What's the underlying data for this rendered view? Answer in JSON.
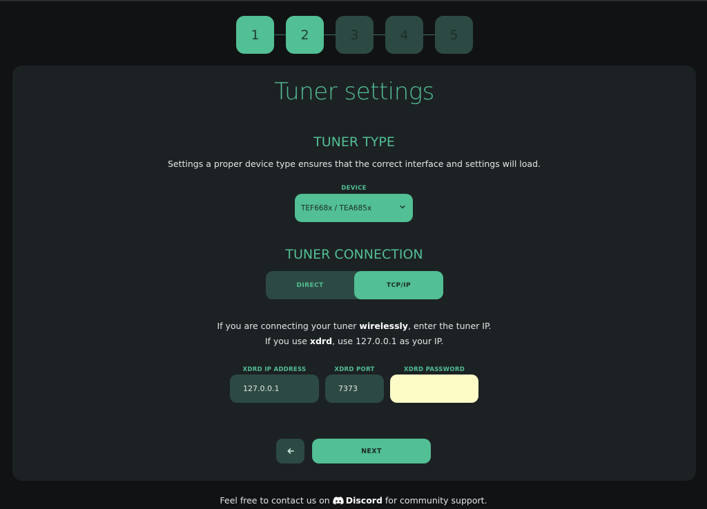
{
  "stepper": {
    "steps": [
      {
        "label": "1",
        "state": "active"
      },
      {
        "label": "2",
        "state": "active"
      },
      {
        "label": "3",
        "state": "inactive"
      },
      {
        "label": "4",
        "state": "inactive"
      },
      {
        "label": "5",
        "state": "inactive"
      }
    ]
  },
  "page": {
    "title": "Tuner settings"
  },
  "tuner_type": {
    "heading": "TUNER TYPE",
    "description": "Settings a proper device type ensures that the correct interface and settings will load.",
    "device_label": "DEVICE",
    "device_value": "TEF668x / TEA685x"
  },
  "tuner_connection": {
    "heading": "TUNER CONNECTION",
    "options": [
      {
        "label": "DIRECT",
        "selected": false
      },
      {
        "label": "TCP/IP",
        "selected": true
      }
    ],
    "info_line1_prefix": "If you are connecting your tuner ",
    "info_line1_bold": "wirelessly",
    "info_line1_suffix": ", enter the tuner IP.",
    "info_line2_prefix": "If you use ",
    "info_line2_bold": "xdrd",
    "info_line2_suffix": ", use 127.0.0.1 as your IP."
  },
  "xdrd": {
    "ip_label": "XDRD IP ADDRESS",
    "ip_value": "127.0.0.1",
    "port_label": "XDRD PORT",
    "port_value": "7373",
    "password_label": "XDRD PASSWORD",
    "password_value": ""
  },
  "nav": {
    "back_icon": "arrow-left-icon",
    "next_label": "NEXT"
  },
  "footer": {
    "prefix": "Feel free to contact us on ",
    "link": "Discord",
    "suffix": " for community support.",
    "icon": "discord-icon"
  },
  "colors": {
    "accent": "#52bf94",
    "accent_dark": "#2c4a43",
    "card_bg": "#1c2124",
    "page_bg": "#111214",
    "password_bg": "#fdfcc6"
  }
}
